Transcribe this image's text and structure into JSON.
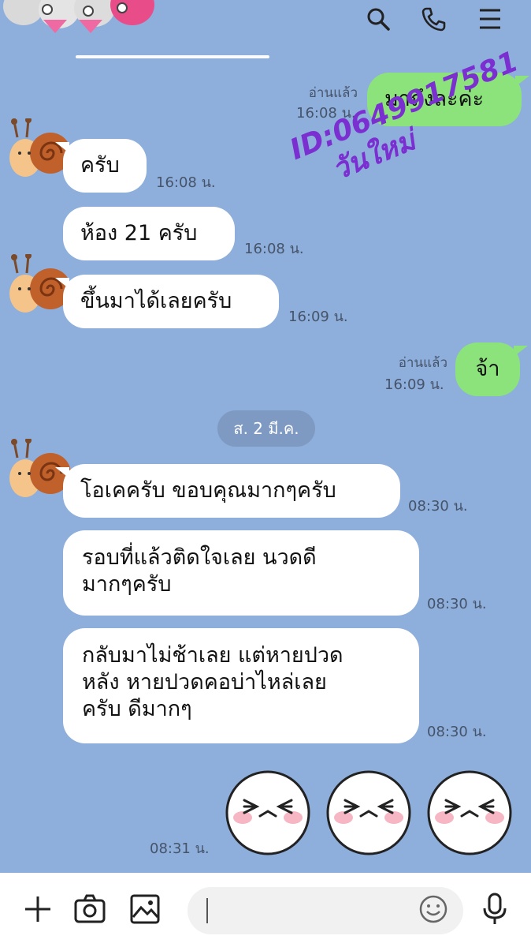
{
  "colors": {
    "background": "#8eaedb",
    "bubble_me": "#8ce37c",
    "bubble_them": "#ffffff",
    "watermark": "#7b2fd1"
  },
  "header": {
    "icons": [
      "search-icon",
      "phone-icon",
      "menu-icon"
    ]
  },
  "messages": {
    "m1": {
      "text": "มาถึงละค่ะ",
      "read": "อ่านแล้ว",
      "time": "16:08 น."
    },
    "m2": {
      "text": "ครับ",
      "time": "16:08 น."
    },
    "m3": {
      "text": "ห้อง 21 ครับ",
      "time": "16:08 น."
    },
    "m4": {
      "text": "ขึ้นมาได้เลยครับ",
      "time": "16:09 น."
    },
    "m5": {
      "text": "จ้า",
      "read": "อ่านแล้ว",
      "time": "16:09 น."
    },
    "m6": {
      "text": "โอเคครับ ขอบคุณมากๆครับ",
      "time": "08:30 น."
    },
    "m7": {
      "line1": "รอบที่แล้วติดใจเลย นวดดี",
      "line2": "มากๆครับ",
      "time": "08:30 น."
    },
    "m8": {
      "line1": "กลับมาไม่ช้าเลย แต่หายปวด",
      "line2": "หลัง หายปวดคอบ่าไหล่เลย",
      "line3": "ครับ ดีมากๆ",
      "time": "08:30 น."
    },
    "stickers": {
      "time": "08:31 น.",
      "icons": [
        "laughing-face-sticker",
        "laughing-face-sticker",
        "laughing-face-sticker"
      ]
    }
  },
  "date_separator": "ส. 2 มี.ค.",
  "watermark": {
    "line1": "ID:0649917581",
    "line2": "วันใหม่"
  },
  "input_bar": {
    "placeholder": "",
    "icons": [
      "plus-icon",
      "camera-icon",
      "image-icon",
      "emoji-icon",
      "microphone-icon"
    ]
  }
}
